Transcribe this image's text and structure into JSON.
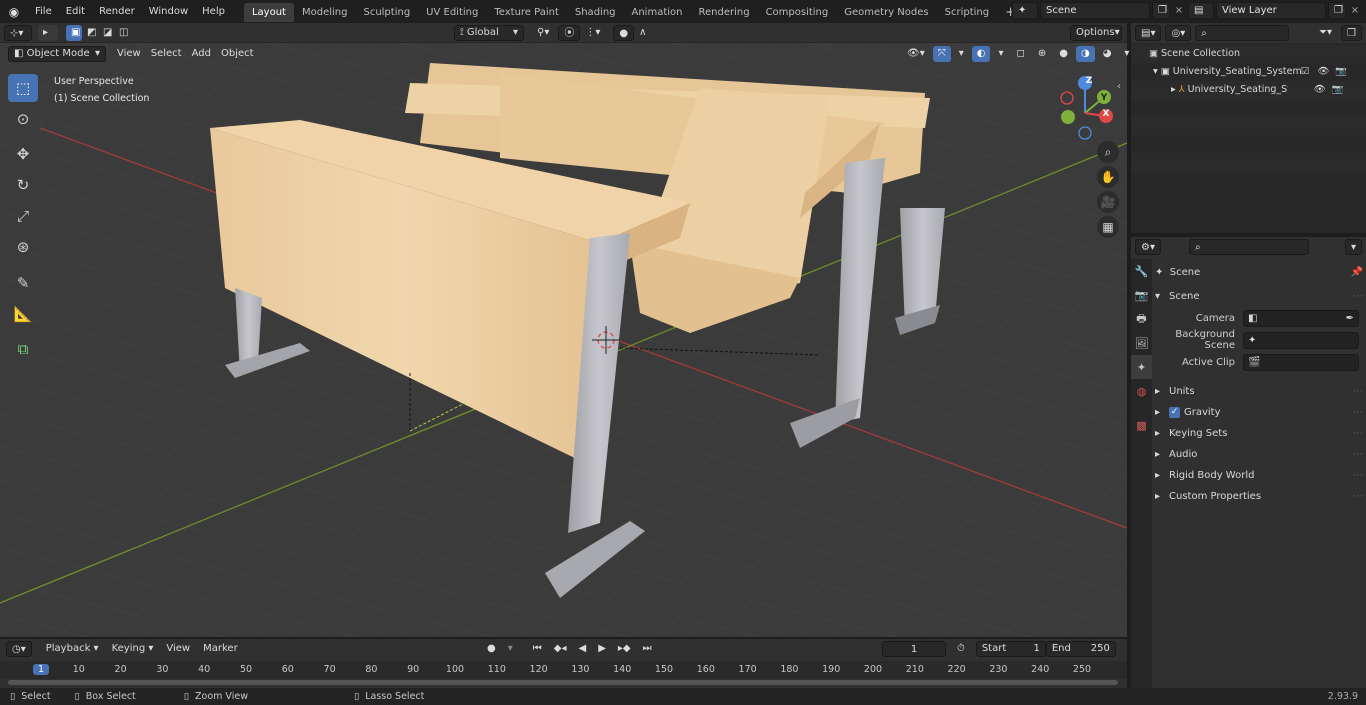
{
  "top_menu": [
    "File",
    "Edit",
    "Render",
    "Window",
    "Help"
  ],
  "workspace_tabs": [
    "Layout",
    "Modeling",
    "Sculpting",
    "UV Editing",
    "Texture Paint",
    "Shading",
    "Animation",
    "Rendering",
    "Compositing",
    "Geometry Nodes",
    "Scripting"
  ],
  "active_tab": "Layout",
  "scene_name": "Scene",
  "view_layer": "View Layer",
  "viewport_header": {
    "mode": "Object Mode",
    "menus": [
      "View",
      "Select",
      "Add",
      "Object"
    ],
    "transform": "Global",
    "options": "Options"
  },
  "viewport": {
    "perspective": "User Perspective",
    "collection": "(1) Scene Collection",
    "gizmo": {
      "z": "Z",
      "y": "Y",
      "x": "X"
    }
  },
  "outliner": {
    "root": "Scene Collection",
    "items": [
      "University_Seating_System_S",
      "University_Seating_Syste"
    ]
  },
  "properties": {
    "context": "Scene",
    "panel": "Scene",
    "fields": [
      {
        "label": "Camera"
      },
      {
        "label": "Background Scene"
      },
      {
        "label": "Active Clip"
      }
    ],
    "subpanels": [
      "Units",
      "Gravity",
      "Keying Sets",
      "Audio",
      "Rigid Body World",
      "Custom Properties"
    ]
  },
  "timeline": {
    "menus": [
      "Playback",
      "Keying",
      "View",
      "Marker"
    ],
    "current_frame": "1",
    "start_label": "Start",
    "start": "1",
    "end_label": "End",
    "end": "250",
    "ruler": [
      "1",
      "10",
      "20",
      "30",
      "40",
      "50",
      "60",
      "70",
      "80",
      "90",
      "100",
      "110",
      "120",
      "130",
      "140",
      "150",
      "160",
      "170",
      "180",
      "190",
      "200",
      "210",
      "220",
      "230",
      "240",
      "250"
    ]
  },
  "statusbar": {
    "items": [
      "Select",
      "Box Select",
      "Zoom View",
      "Lasso Select"
    ],
    "version": "2.93.9"
  }
}
